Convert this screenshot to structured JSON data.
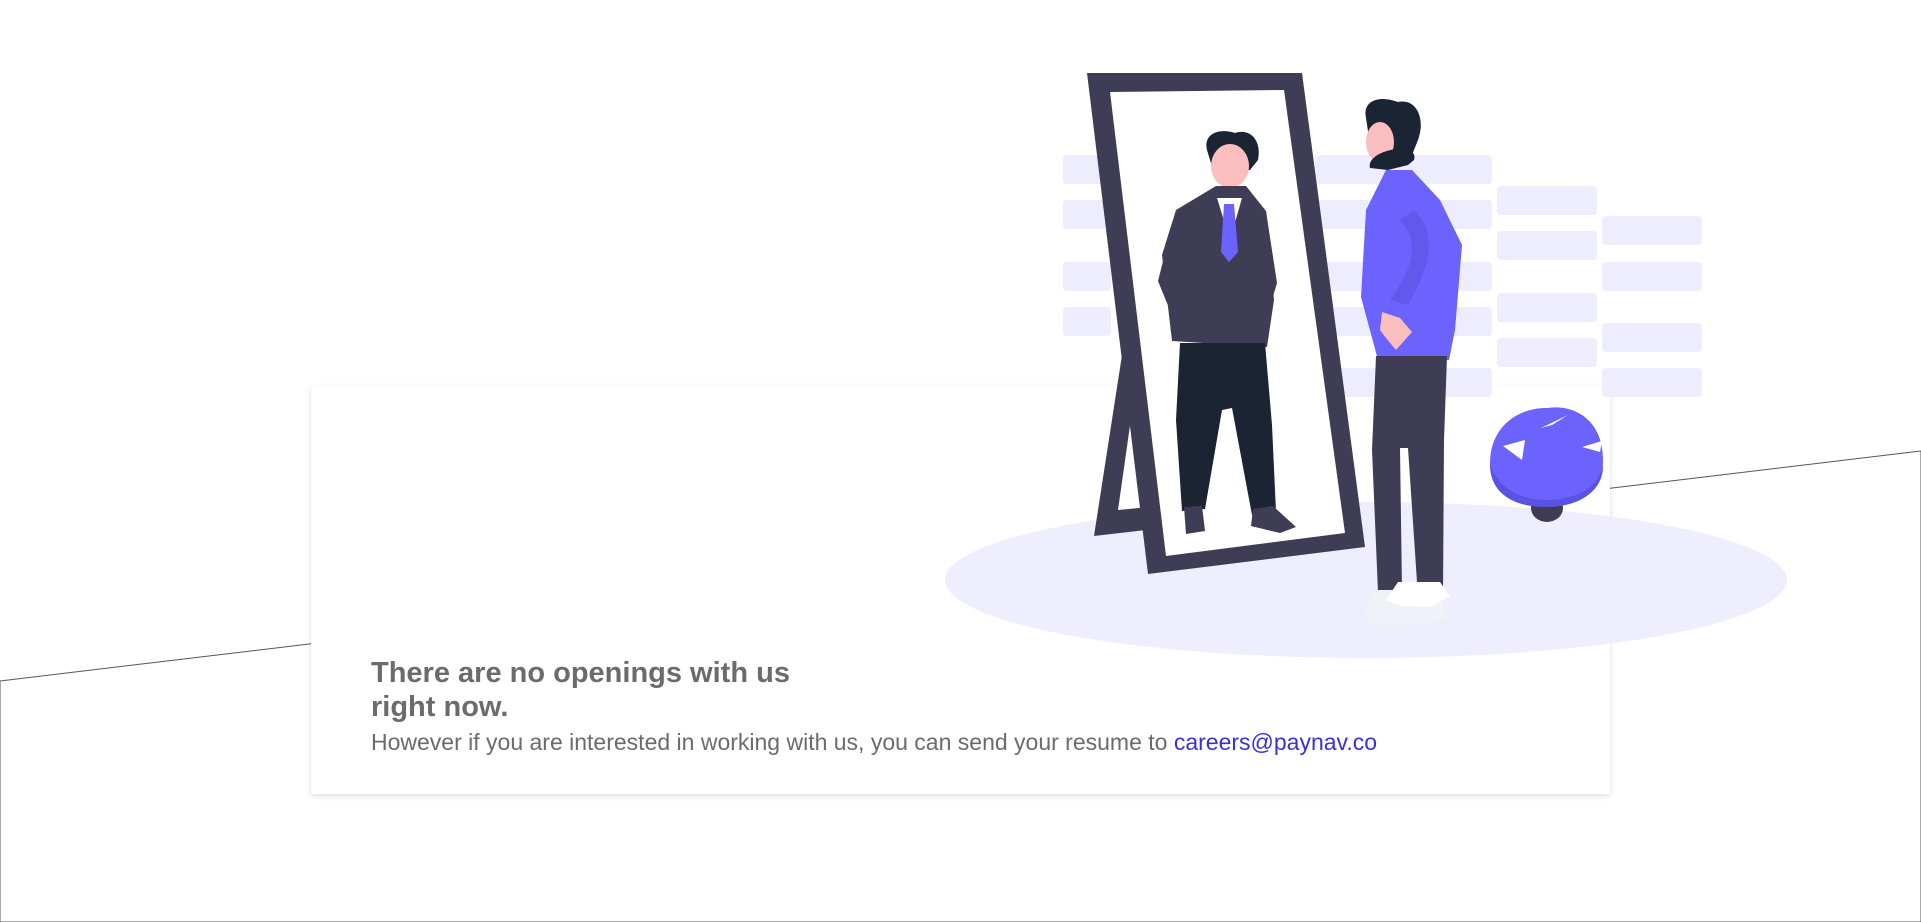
{
  "message": {
    "headline": "There are no openings with us right now.",
    "body_prefix": "However if you are interested in working with us, you can send your resume to ",
    "email_link": "careers@paynav.co"
  },
  "colors": {
    "accent": "#6c63ff",
    "link": "#3d2fd8",
    "text": "#6b6b6b",
    "dark": "#3f3d56",
    "ground": "#eeedff"
  },
  "illustration": {
    "icon": "man-looking-in-mirror-illustration"
  }
}
